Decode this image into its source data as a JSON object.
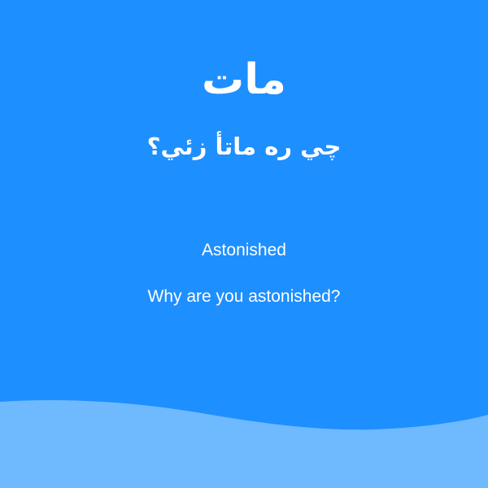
{
  "colors": {
    "background": "#1e8fff",
    "wave": "#6fb9ff",
    "text": "#ffffff"
  },
  "card": {
    "word": "مات",
    "sentence": "چي ره ماتأ زئي؟",
    "translation_word": "Astonished",
    "translation_sentence": "Why are you astonished?"
  }
}
